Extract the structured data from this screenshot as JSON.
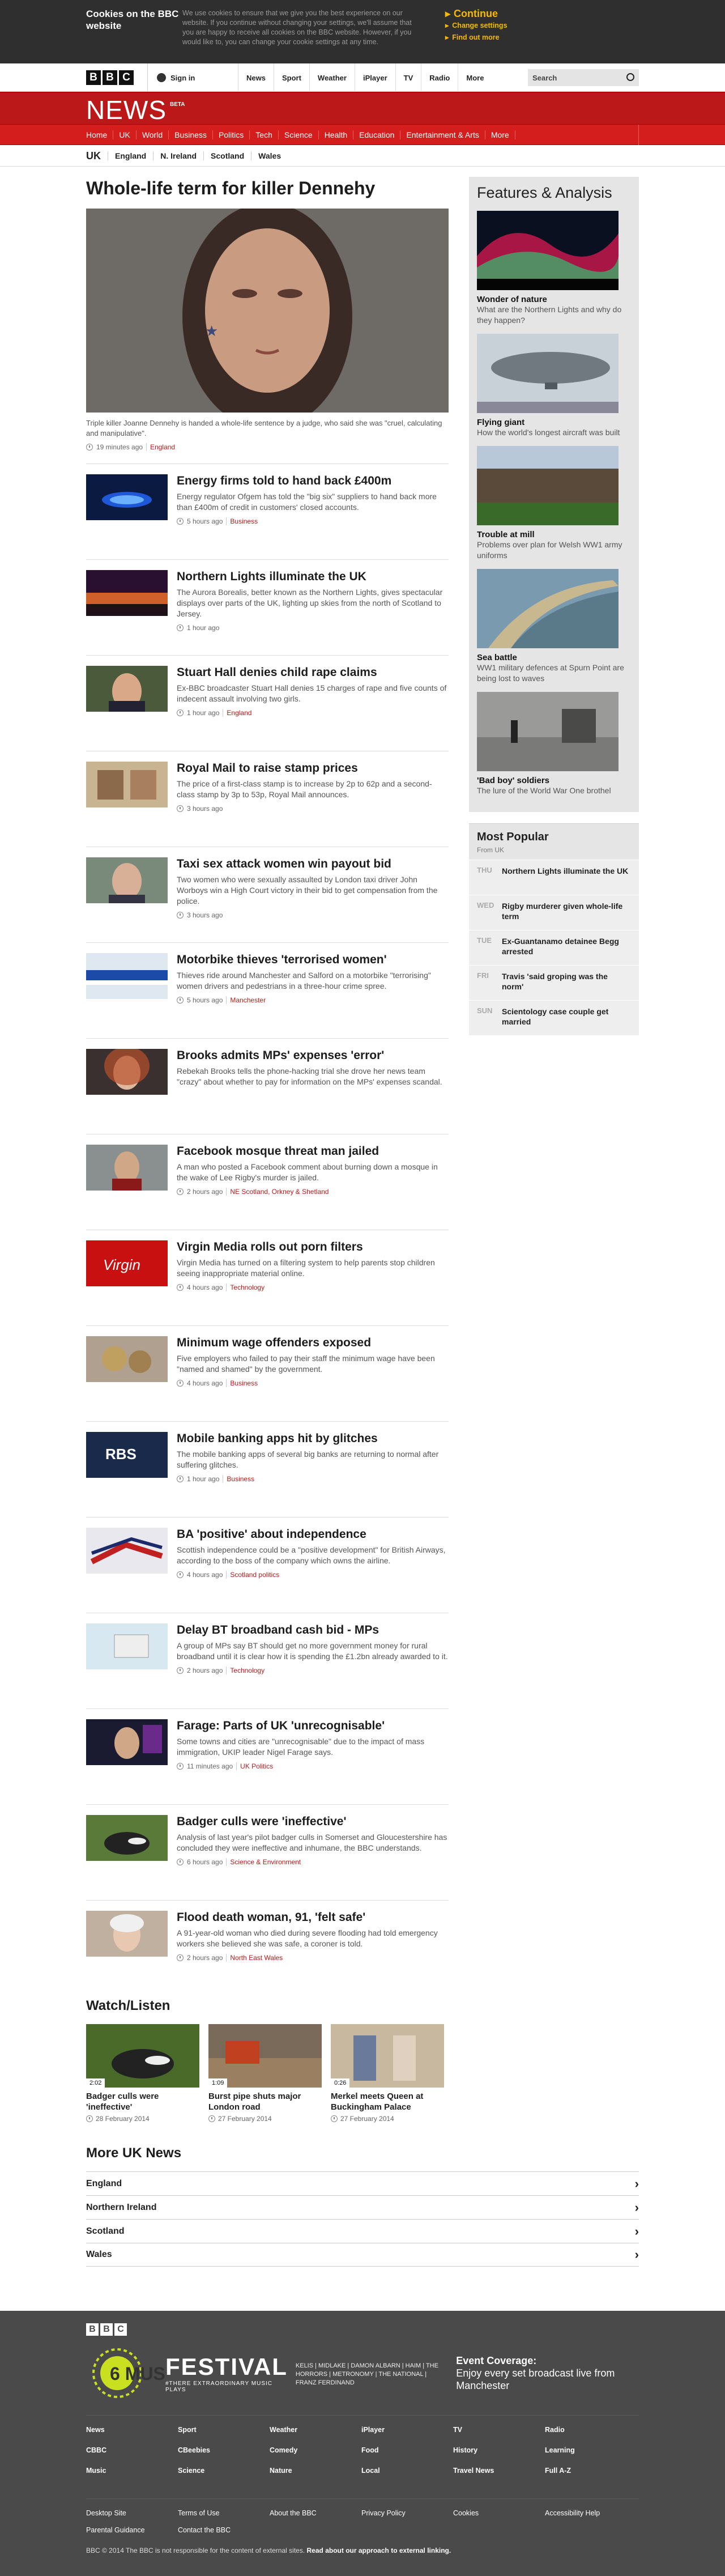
{
  "cookie": {
    "heading": "Cookies on the BBC website",
    "text": "We use cookies to ensure that we give you the best experience on our website. If you continue without changing your settings, we'll assume that you are happy to receive all cookies on the BBC website. However, if you would like to, you can change your cookie settings at any time.",
    "continue": "Continue",
    "change": "Change settings",
    "find": "Find out more"
  },
  "bbcbar": {
    "sign_in": "Sign in",
    "nav": [
      "News",
      "Sport",
      "Weather",
      "iPlayer",
      "TV",
      "Radio",
      "More"
    ],
    "search_placeholder": "Search"
  },
  "news": {
    "title": "NEWS",
    "beta": "BETA",
    "nav": [
      "Home",
      "UK",
      "World",
      "Business",
      "Politics",
      "Tech",
      "Science",
      "Health",
      "Education",
      "Entertainment & Arts",
      "More"
    ],
    "subnav": [
      "UK",
      "England",
      "N. Ireland",
      "Scotland",
      "Wales"
    ]
  },
  "lead": {
    "headline": "Whole-life term for killer Dennehy",
    "caption": "Triple killer Joanne Dennehy is handed a whole-life sentence by a judge, who said she was \"cruel, calculating and manipulative\".",
    "time": "19 minutes ago",
    "tag": "England"
  },
  "stories": [
    {
      "title": "Energy firms told to hand back £400m",
      "summary": "Energy regulator Ofgem has told the \"big six\" suppliers to hand back more than £400m of credit in customers' closed accounts.",
      "time": "5 hours ago",
      "tag": "Business"
    },
    {
      "title": "Northern Lights illuminate the UK",
      "summary": "The Aurora Borealis, better known as the Northern Lights, gives spectacular displays over parts of the UK, lighting up skies from the north of Scotland to Jersey.",
      "time": "1 hour ago",
      "tag": ""
    },
    {
      "title": "Stuart Hall denies child rape claims",
      "summary": "Ex-BBC broadcaster Stuart Hall denies 15 charges of rape and five counts of indecent assault involving two girls.",
      "time": "1 hour ago",
      "tag": "England"
    },
    {
      "title": "Royal Mail to raise stamp prices",
      "summary": "The price of a first-class stamp is to increase by 2p to 62p and a second-class stamp by 3p to 53p, Royal Mail announces.",
      "time": "3 hours ago",
      "tag": ""
    },
    {
      "title": "Taxi sex attack women win payout bid",
      "summary": "Two women who were sexually assaulted by London taxi driver John Worboys win a High Court victory in their bid to get compensation from the police.",
      "time": "3 hours ago",
      "tag": ""
    },
    {
      "title": "Motorbike thieves 'terrorised women'",
      "summary": "Thieves ride around Manchester and Salford on a motorbike \"terrorising\" women drivers and pedestrians in a three-hour crime spree.",
      "time": "5 hours ago",
      "tag": "Manchester"
    },
    {
      "title": "Brooks admits MPs' expenses 'error'",
      "summary": "Rebekah Brooks tells the phone-hacking trial she drove her news team \"crazy\" about whether to pay for information on the MPs' expenses scandal.",
      "time": "",
      "tag": ""
    },
    {
      "title": "Facebook mosque threat man jailed",
      "summary": "A man who posted a Facebook comment about burning down a mosque in the wake of Lee Rigby's murder is jailed.",
      "time": "2 hours ago",
      "tag": "NE Scotland, Orkney & Shetland"
    },
    {
      "title": "Virgin Media rolls out porn filters",
      "summary": "Virgin Media has turned on a filtering system to help parents stop children seeing inappropriate material online.",
      "time": "4 hours ago",
      "tag": "Technology"
    },
    {
      "title": "Minimum wage offenders exposed",
      "summary": "Five employers who failed to pay their staff the minimum wage have been \"named and shamed\" by the government.",
      "time": "4 hours ago",
      "tag": "Business"
    },
    {
      "title": "Mobile banking apps hit by glitches",
      "summary": "The mobile banking apps of several big banks are returning to normal after suffering glitches.",
      "time": "1 hour ago",
      "tag": "Business"
    },
    {
      "title": "BA 'positive' about independence",
      "summary": "Scottish independence could be a \"positive development\" for British Airways, according to the boss of the company which owns the airline.",
      "time": "4 hours ago",
      "tag": "Scotland politics"
    },
    {
      "title": "Delay BT broadband cash bid - MPs",
      "summary": "A group of MPs say BT should get no more government money for rural broadband until it is clear how it is spending the £1.2bn already awarded to it.",
      "time": "2 hours ago",
      "tag": "Technology"
    },
    {
      "title": "Farage: Parts of UK 'unrecognisable'",
      "summary": "Some towns and cities are \"unrecognisable\" due to the impact of mass immigration, UKIP leader Nigel Farage says.",
      "time": "11 minutes ago",
      "tag": "UK Politics"
    },
    {
      "title": "Badger culls were 'ineffective'",
      "summary": "Analysis of last year's pilot badger culls in Somerset and Gloucestershire has concluded they were ineffective and inhumane, the BBC understands.",
      "time": "6 hours ago",
      "tag": "Science & Environment"
    },
    {
      "title": "Flood death woman, 91, 'felt safe'",
      "summary": "A 91-year-old woman who died during severe flooding had told emergency workers she believed she was safe, a coroner is told.",
      "time": "2 hours ago",
      "tag": "North East Wales"
    }
  ],
  "features": {
    "heading": "Features & Analysis",
    "items": [
      {
        "title": "Wonder of nature",
        "desc": "What are the Northern Lights and why do they happen?"
      },
      {
        "title": "Flying giant",
        "desc": "How the world's longest aircraft was built"
      },
      {
        "title": "Trouble at mill",
        "desc": "Problems over plan for Welsh WW1 army uniforms"
      },
      {
        "title": "Sea battle",
        "desc": "WW1 military defences at Spurn Point are being lost to waves"
      },
      {
        "title": "'Bad boy' soldiers",
        "desc": "The lure of the World War One brothel"
      }
    ]
  },
  "most_popular": {
    "heading": "Most Popular",
    "from": "From UK",
    "items": [
      {
        "day": "THU",
        "title": "Northern Lights illuminate the UK"
      },
      {
        "day": "WED",
        "title": "Rigby murderer given whole-life term"
      },
      {
        "day": "TUE",
        "title": "Ex-Guantanamo detainee Begg arrested"
      },
      {
        "day": "FRI",
        "title": "Travis 'said groping was the norm'"
      },
      {
        "day": "SUN",
        "title": "Scientology case couple get married"
      }
    ]
  },
  "watch": {
    "heading": "Watch/Listen",
    "items": [
      {
        "duration": "2:02",
        "title": "Badger culls were 'ineffective'",
        "date": "28 February 2014"
      },
      {
        "duration": "1:09",
        "title": "Burst pipe shuts major London road",
        "date": "27 February 2014"
      },
      {
        "duration": "0:26",
        "title": "Merkel meets Queen at Buckingham Palace",
        "date": "27 February 2014"
      }
    ]
  },
  "more_uk": {
    "heading": "More UK News",
    "items": [
      "England",
      "Northern Ireland",
      "Scotland",
      "Wales"
    ]
  },
  "footer": {
    "festival": "FESTIVAL",
    "festival_sub": "6 MUSIC",
    "festival_tag": "#THERE EXTRAORDINARY MUSIC PLAYS",
    "lineup": "KELIS | MIDLAKE | DAMON ALBARN | HAIM | THE HORRORS | METRONOMY | THE NATIONAL | FRANZ FERDINAND",
    "event_a": "Event Coverage:",
    "event_b": "Enjoy every set broadcast live from Manchester",
    "links": [
      "News",
      "Sport",
      "Weather",
      "iPlayer",
      "TV",
      "Radio",
      "CBBC",
      "CBeebies",
      "Comedy",
      "Food",
      "History",
      "Learning",
      "Music",
      "Science",
      "Nature",
      "Local",
      "Travel News",
      "Full A-Z"
    ],
    "links2": [
      "Desktop Site",
      "Terms of Use",
      "About the BBC",
      "Privacy Policy",
      "Cookies",
      "Accessibility Help",
      "Parental Guidance",
      "Contact the BBC"
    ],
    "copy": "BBC © 2014 The BBC is not responsible for the content of external sites.",
    "copy_link": "Read about our approach to external linking."
  }
}
